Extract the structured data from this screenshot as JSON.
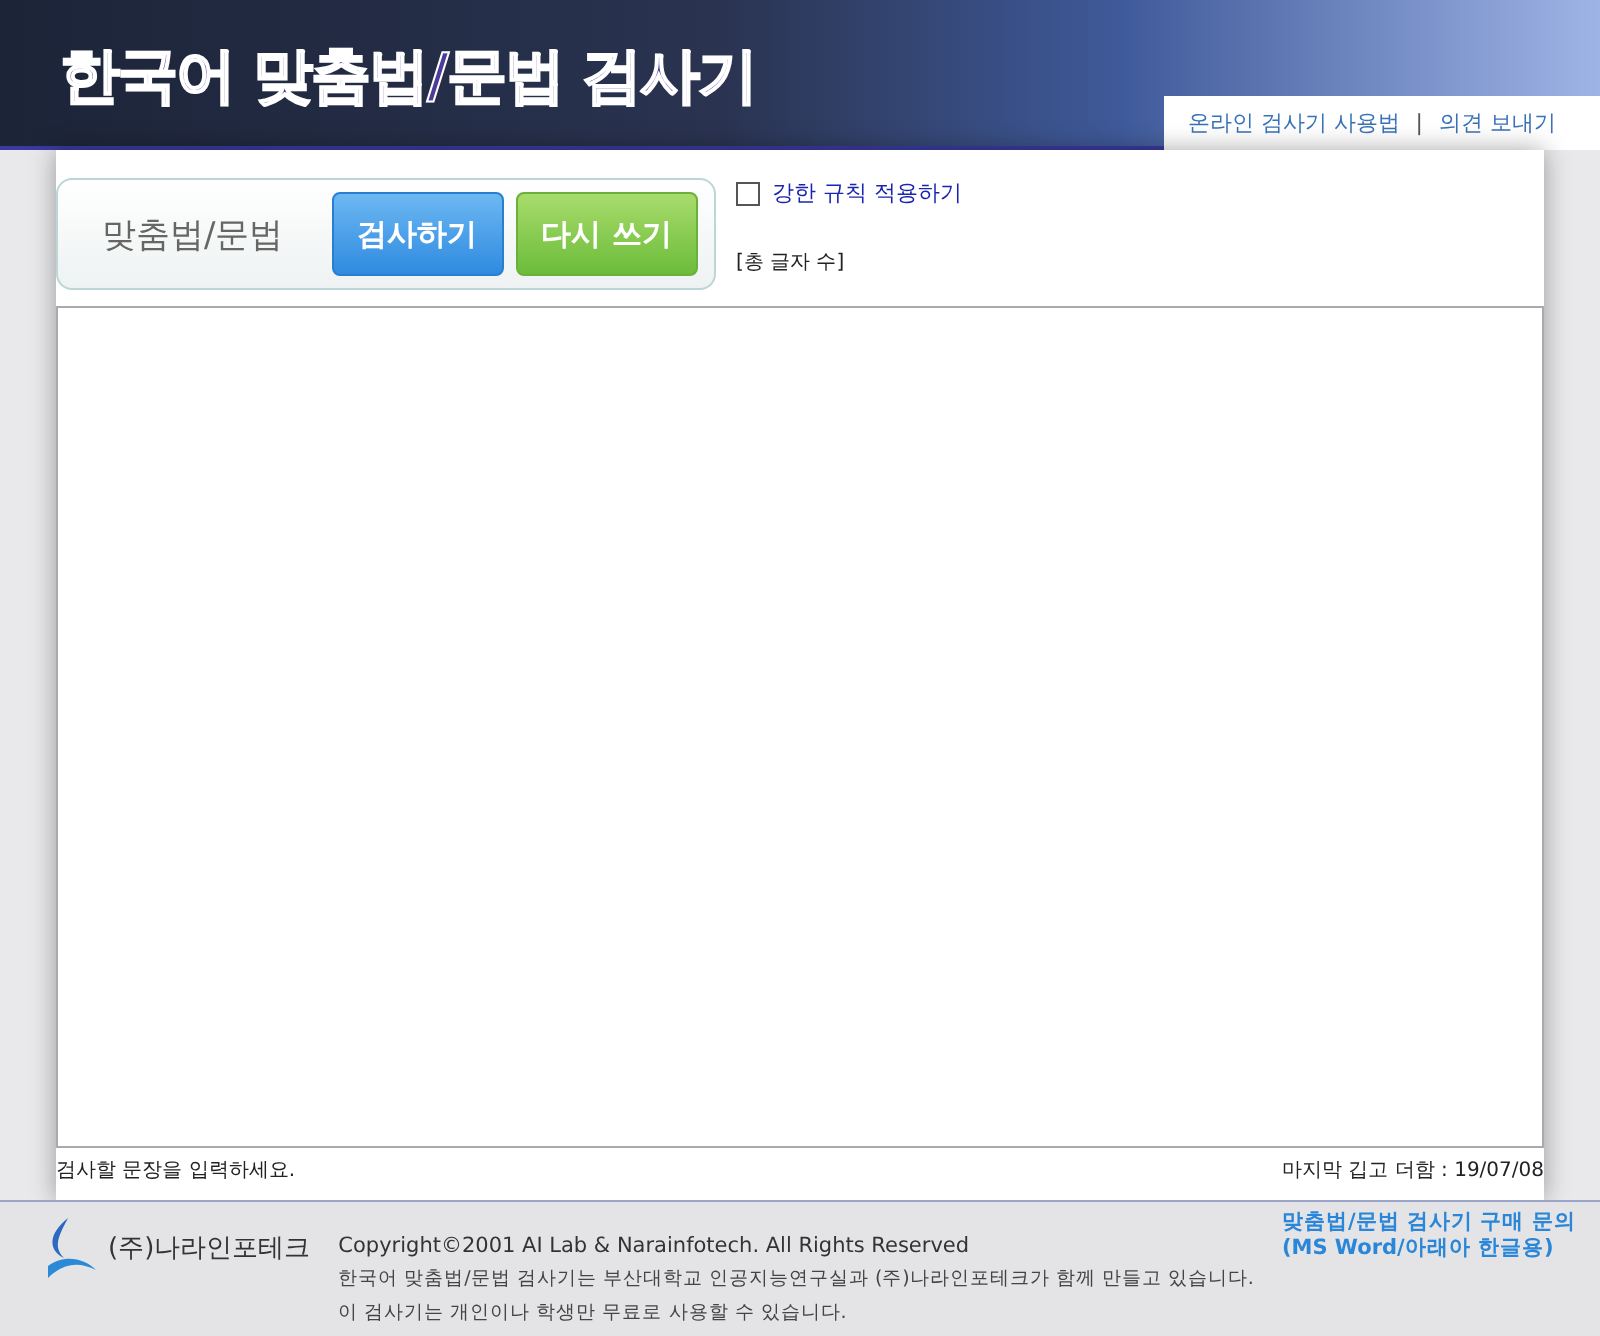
{
  "header": {
    "title": "한국어 맞춤법/문법 검사기",
    "links": [
      "온라인 검사기 사용법",
      "의견 보내기"
    ],
    "separator": "|"
  },
  "toolbar": {
    "label": "맞춤법/문법",
    "buttons": [
      {
        "label": "검사하기",
        "kind": "check"
      },
      {
        "label": "다시 쓰기",
        "kind": "reset"
      }
    ],
    "option": {
      "label": "강한 규칙 적용하기",
      "checked": false
    },
    "char_count": "[총 글자 수]"
  },
  "editor": {
    "hint": "검사할 문장을 입력하세요.",
    "last_update": "마지막 깁고 더함 : 19/07/08"
  },
  "footer": {
    "company": "(주)나라인포테크",
    "copyright": "Copyright©2001 AI Lab & Narainfotech. All Rights Reserved",
    "lines": [
      "한국어 맞춤법/문법 검사기는 부산대학교 인공지능연구실과 (주)나라인포테크가 함께 만들고 있습니다.",
      "이 검사기는 개인이나 학생만 무료로 사용할 수 있습니다."
    ],
    "purchase": [
      "맞춤법/문법 검사기 구매 문의",
      "(MS Word/아래아 한글용)"
    ]
  }
}
